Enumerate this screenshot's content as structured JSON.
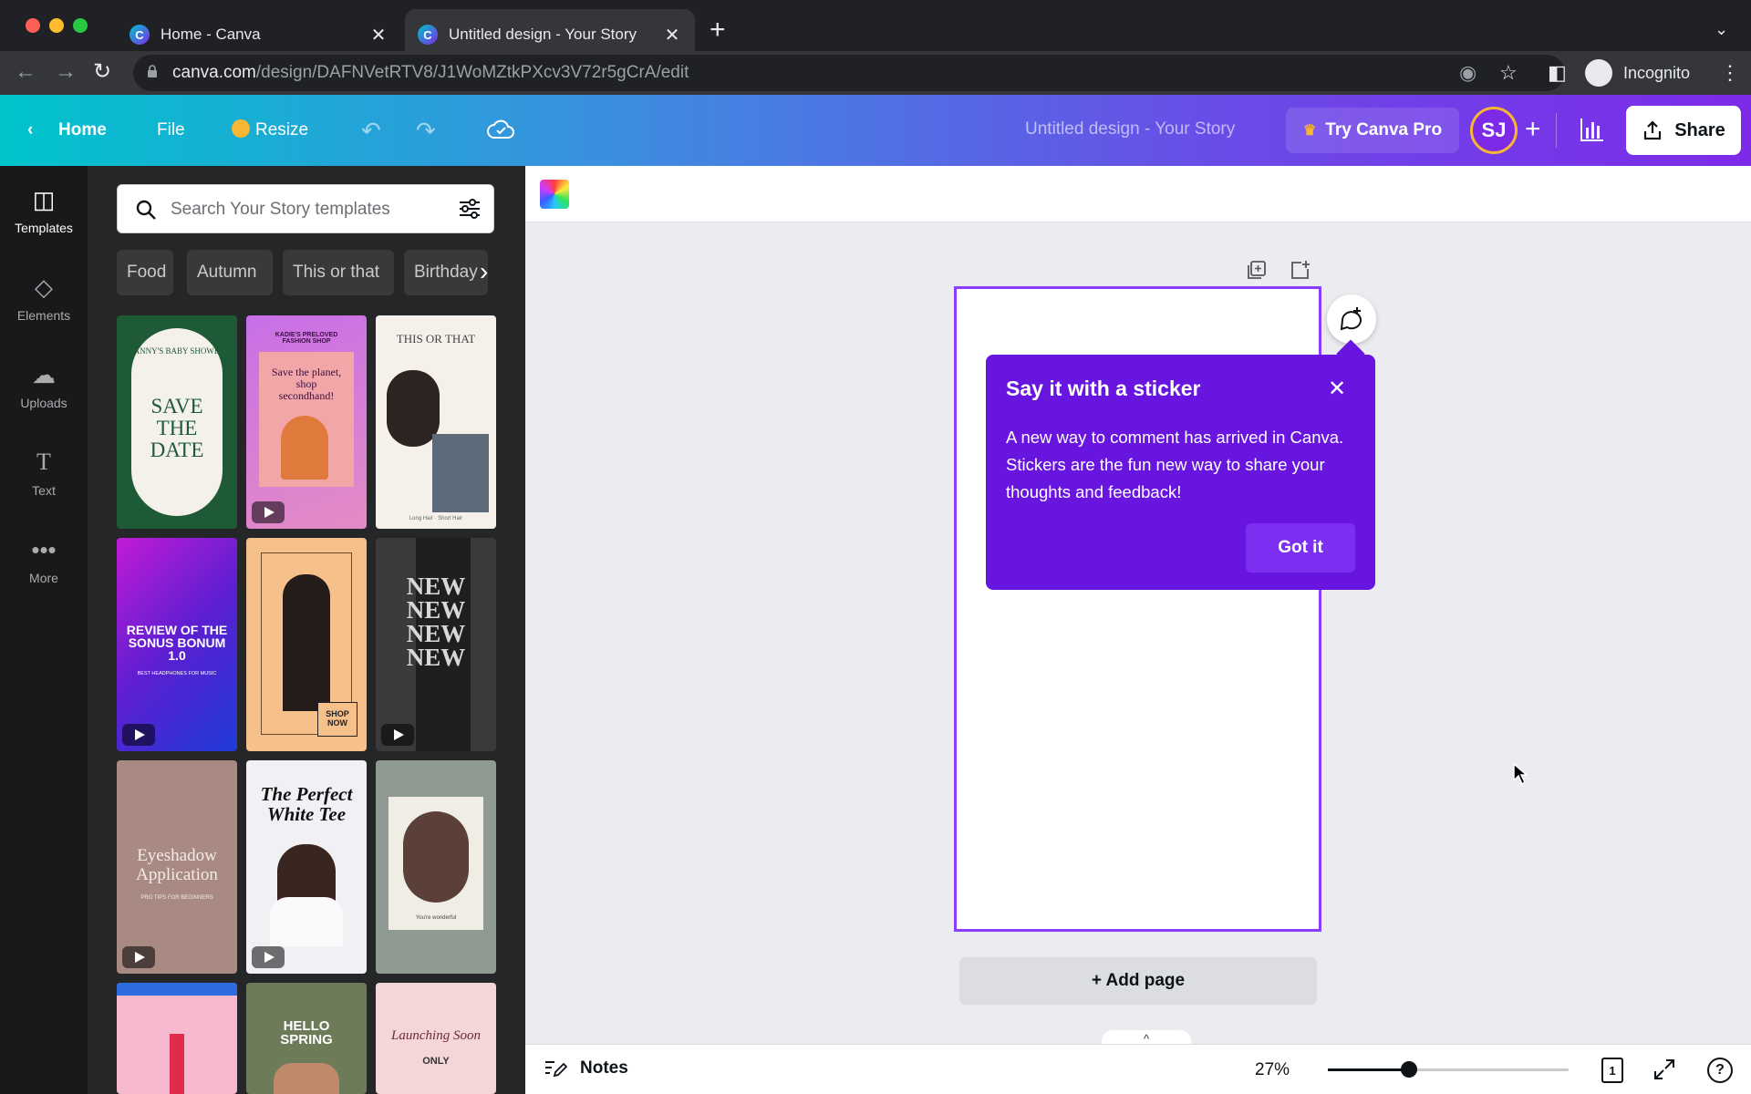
{
  "browser": {
    "tabs": [
      {
        "label": "Home - Canva"
      },
      {
        "label": "Untitled design - Your Story"
      }
    ],
    "url_domain": "canva.com",
    "url_path": "/design/DAFNVetRTV8/J1WoMZtkPXcv3V72r5gCrA/edit",
    "incognito_label": "Incognito",
    "traffic_colors": [
      "#ff5f57",
      "#febc2e",
      "#28c840"
    ]
  },
  "header": {
    "home_label": "Home",
    "file_label": "File",
    "resize_label": "Resize",
    "design_title": "Untitled design - Your Story",
    "try_pro_label": "Try Canva Pro",
    "avatar_initials": "SJ",
    "share_label": "Share",
    "gradient": [
      "#00c4cc",
      "#7d2ae8"
    ]
  },
  "rail": {
    "items": [
      {
        "label": "Templates",
        "icon": "templates-icon"
      },
      {
        "label": "Elements",
        "icon": "elements-icon"
      },
      {
        "label": "Uploads",
        "icon": "uploads-icon"
      },
      {
        "label": "Text",
        "icon": "text-icon"
      },
      {
        "label": "More",
        "icon": "more-icon"
      }
    ]
  },
  "panel": {
    "search_placeholder": "Search Your Story templates",
    "chips": [
      "Food",
      "Autumn",
      "This or that",
      "Birthday"
    ],
    "templates": [
      {
        "text": "SAVE THE DATE",
        "sub": "SANNY'S BABY SHOWER"
      },
      {
        "text": "Save the planet, shop secondhand!",
        "sub": "KADIE'S PRELOVED FASHION SHOP"
      },
      {
        "text": "THIS OR THAT",
        "sub": "Long Hair · Short Hair"
      },
      {
        "text": "REVIEW OF THE SONUS BONUM 1.0",
        "sub": "BEST HEADPHONES FOR MUSIC"
      },
      {
        "text": "SHOP NOW",
        "sub": ""
      },
      {
        "text": "NEW NEW NEW NEW",
        "sub": ""
      },
      {
        "text": "Eyeshadow Application",
        "sub": "PRO TIPS FOR BEGINNERS"
      },
      {
        "text": "The Perfect White Tee",
        "sub": ""
      },
      {
        "text": "You're wonderful",
        "sub": ""
      },
      {
        "text": "",
        "sub": ""
      },
      {
        "text": "HELLO SPRING",
        "sub": ""
      },
      {
        "text": "Launching Soon",
        "sub": "ONLY"
      }
    ]
  },
  "editor": {
    "popup": {
      "title": "Say it with a sticker",
      "body": "A new way to comment has arrived in Canva. Stickers are the fun new way to share your thoughts and feedback!",
      "button": "Got it"
    },
    "add_page_label": "+ Add page",
    "accent": "#8b3dff",
    "popup_color": "#6915e0"
  },
  "footer": {
    "notes_label": "Notes",
    "zoom_label": "27%",
    "zoom_level": 0.27,
    "page_count": "1",
    "help_label": "?"
  }
}
